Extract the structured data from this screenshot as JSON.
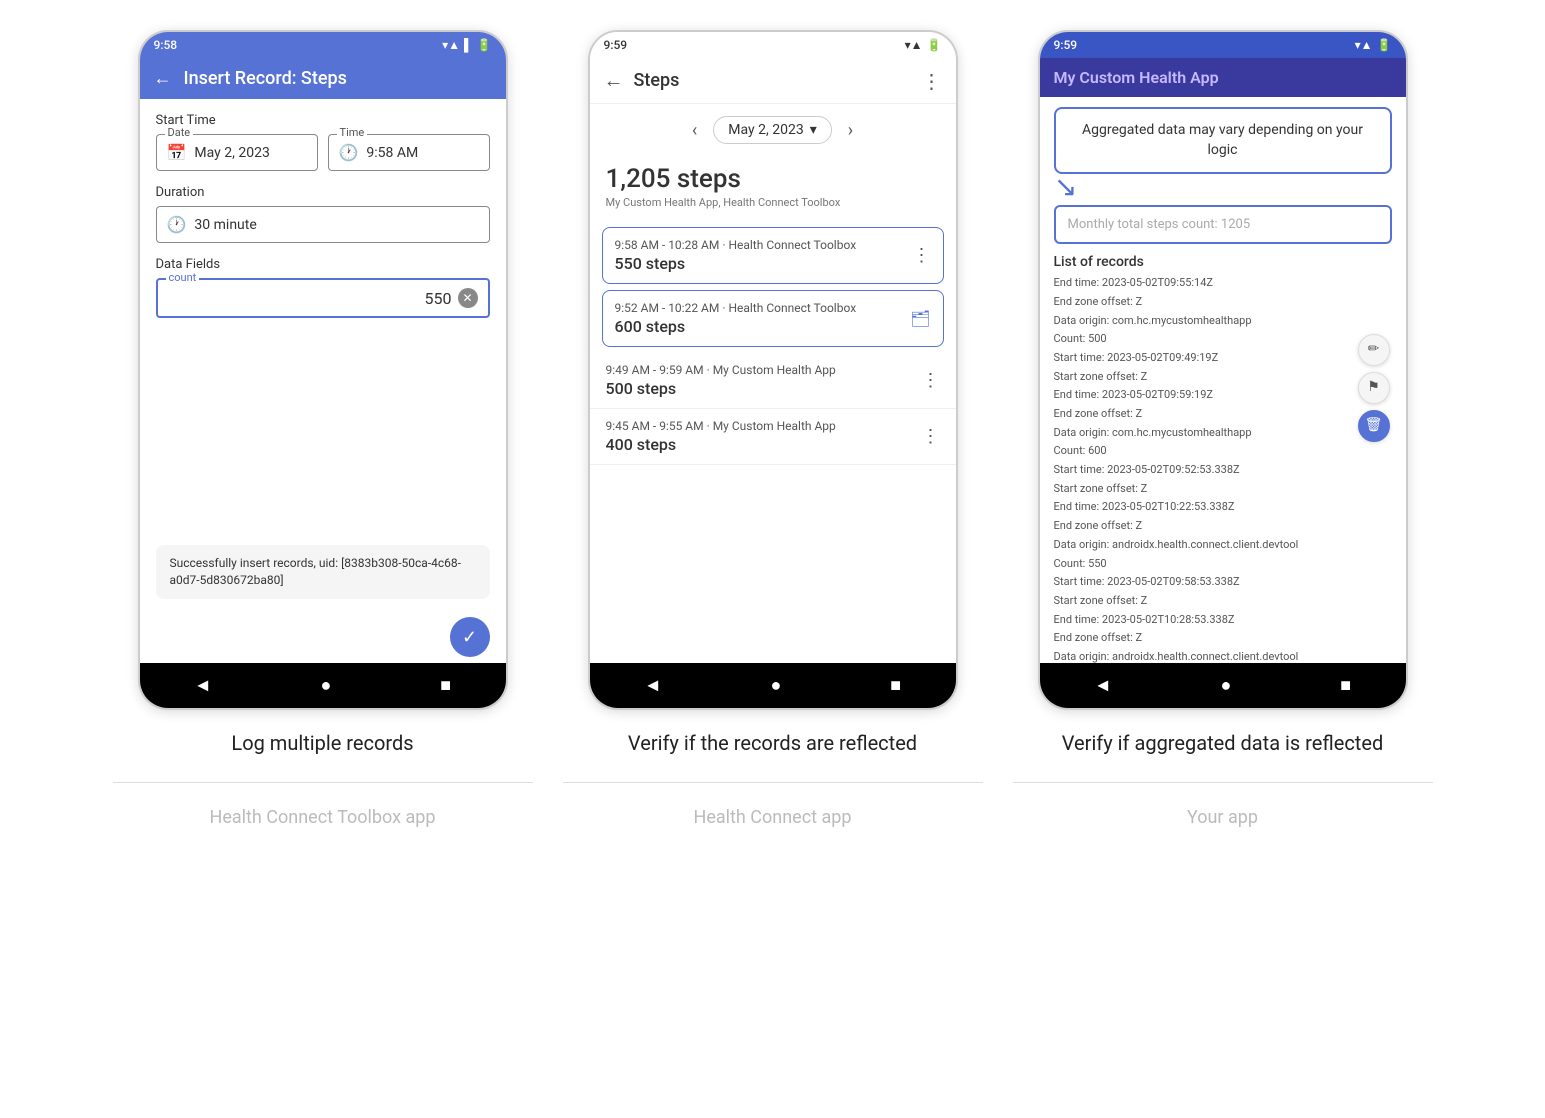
{
  "phone1": {
    "status_time": "9:58",
    "app_bar_title": "Insert Record: Steps",
    "start_time_label": "Start Time",
    "date_field_label": "Date",
    "date_value": "May 2, 2023",
    "time_field_label": "Time",
    "time_value": "9:58 AM",
    "duration_label": "Duration",
    "duration_value": "30 minute",
    "data_fields_label": "Data Fields",
    "count_field_label": "count",
    "count_value": "550",
    "success_message": "Successfully insert records, uid: [8383b308-50ca-4c68-a0d7-5d830672ba80]",
    "caption": "Log multiple records",
    "caption_sub": "Health Connect Toolbox app"
  },
  "phone2": {
    "status_time": "9:59",
    "screen_title": "Steps",
    "date_display": "May 2, 2023",
    "total_steps": "1,205 steps",
    "steps_source": "My Custom Health App, Health Connect Toolbox",
    "records": [
      {
        "time": "9:58 AM - 10:28 AM · Health Connect Toolbox",
        "steps": "550 steps",
        "highlighted": true
      },
      {
        "time": "9:52 AM - 10:22 AM · Health Connect Toolbox",
        "steps": "600 steps",
        "highlighted": true
      },
      {
        "time": "9:49 AM - 9:59 AM · My Custom Health App",
        "steps": "500 steps",
        "highlighted": false
      },
      {
        "time": "9:45 AM - 9:55 AM · My Custom Health App",
        "steps": "400 steps",
        "highlighted": false
      }
    ],
    "caption": "Verify if the records are reflected",
    "caption_sub": "Health Connect app"
  },
  "phone3": {
    "status_time": "9:59",
    "app_title": "My Custom Health App",
    "tooltip_text": "Aggregated data may vary depending on your logic",
    "monthly_total": "Monthly total steps count: 1205",
    "list_title": "List of records",
    "records_detail": [
      "End time: 2023-05-02T09:55:14Z",
      "End zone offset: Z",
      "Data origin: com.hc.mycustomhealthapp",
      "Count: 500",
      "Start time: 2023-05-02T09:49:19Z",
      "Start zone offset: Z",
      "End time: 2023-05-02T09:59:19Z",
      "End zone offset: Z",
      "Data origin: com.hc.mycustomhealthapp",
      "Count: 600",
      "Start time: 2023-05-02T09:52:53.338Z",
      "Start zone offset: Z",
      "End time: 2023-05-02T10:22:53.338Z",
      "End zone offset: Z",
      "Data origin: androidx.health.connect.client.devtool",
      "Count: 550",
      "Start time: 2023-05-02T09:58:53.338Z",
      "Start zone offset: Z",
      "End time: 2023-05-02T10:28:53.338Z",
      "End zone offset: Z",
      "Data origin: androidx.health.connect.client.devtool"
    ],
    "caption": "Verify if aggregated data is reflected",
    "caption_sub": "Your app"
  },
  "icons": {
    "back": "←",
    "menu": "⋮",
    "calendar": "📅",
    "clock": "🕐",
    "chevron_left": "‹",
    "chevron_right": "›",
    "dropdown": "▾",
    "back_nav": "◄",
    "home_nav": "●",
    "recents_nav": "■",
    "clear": "✕",
    "pencil": "✏",
    "delete": "🗑",
    "briefcase": "🗂"
  }
}
